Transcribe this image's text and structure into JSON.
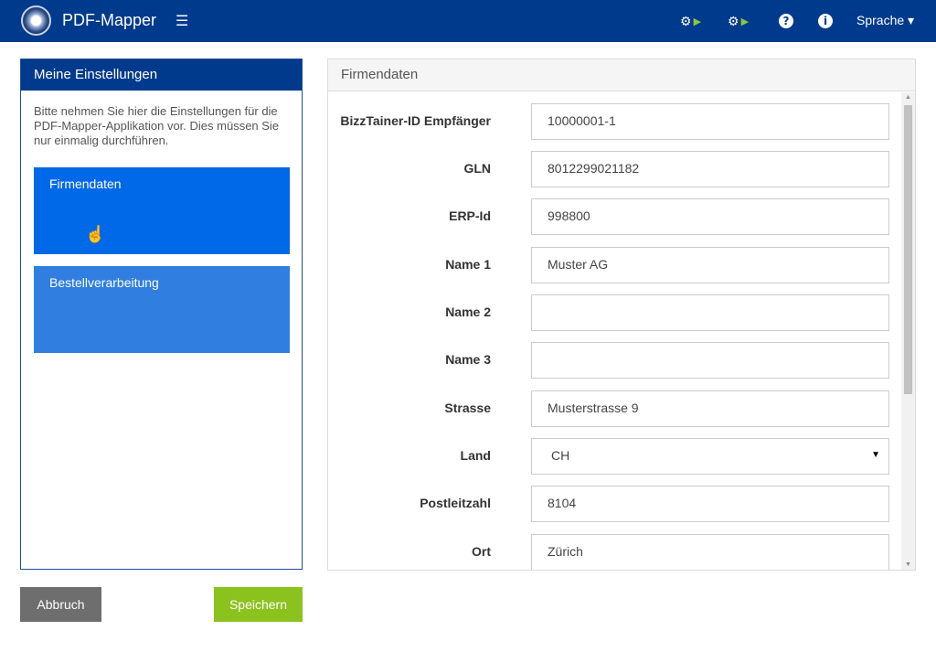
{
  "header": {
    "app_title": "PDF-Mapper",
    "icons": [
      "logo-icon",
      "menu-icon",
      "gear-play-icon",
      "gears-play-icon",
      "help-icon",
      "info-icon"
    ],
    "language_label": "Sprache ▾"
  },
  "sidebar": {
    "title": "Meine Einstellungen",
    "description": "Bitte nehmen Sie hier die Einstellungen für die PDF-Mapper-Applikation vor. Dies müssen Sie nur einmalig durchführen.",
    "tiles": [
      {
        "label": "Firmendaten",
        "active": true
      },
      {
        "label": "Bestellverarbeitung",
        "active": false
      }
    ]
  },
  "actions": {
    "cancel_label": "Abbruch",
    "save_label": "Speichern"
  },
  "form": {
    "title": "Firmendaten",
    "fields": [
      {
        "label": "BizzTainer-ID Empfänger",
        "value": "10000001-1"
      },
      {
        "label": "GLN",
        "value": "8012299021182"
      },
      {
        "label": "ERP-Id",
        "value": "998800"
      },
      {
        "label": "Name 1",
        "value": "Muster AG"
      },
      {
        "label": "Name 2",
        "value": ""
      },
      {
        "label": "Name 3",
        "value": ""
      },
      {
        "label": "Strasse",
        "value": "Musterstrasse 9"
      },
      {
        "label": "Land",
        "value": "CH",
        "type": "select"
      },
      {
        "label": "Postleitzahl",
        "value": "8104"
      },
      {
        "label": "Ort",
        "value": "Zürich"
      }
    ]
  },
  "colors": {
    "topbar": "#003a8c",
    "active_tile": "#0069e8",
    "tile": "#2f7ee0",
    "save": "#8cc21e",
    "cancel": "#6e6e6e",
    "play_accent": "#8cc63f"
  }
}
